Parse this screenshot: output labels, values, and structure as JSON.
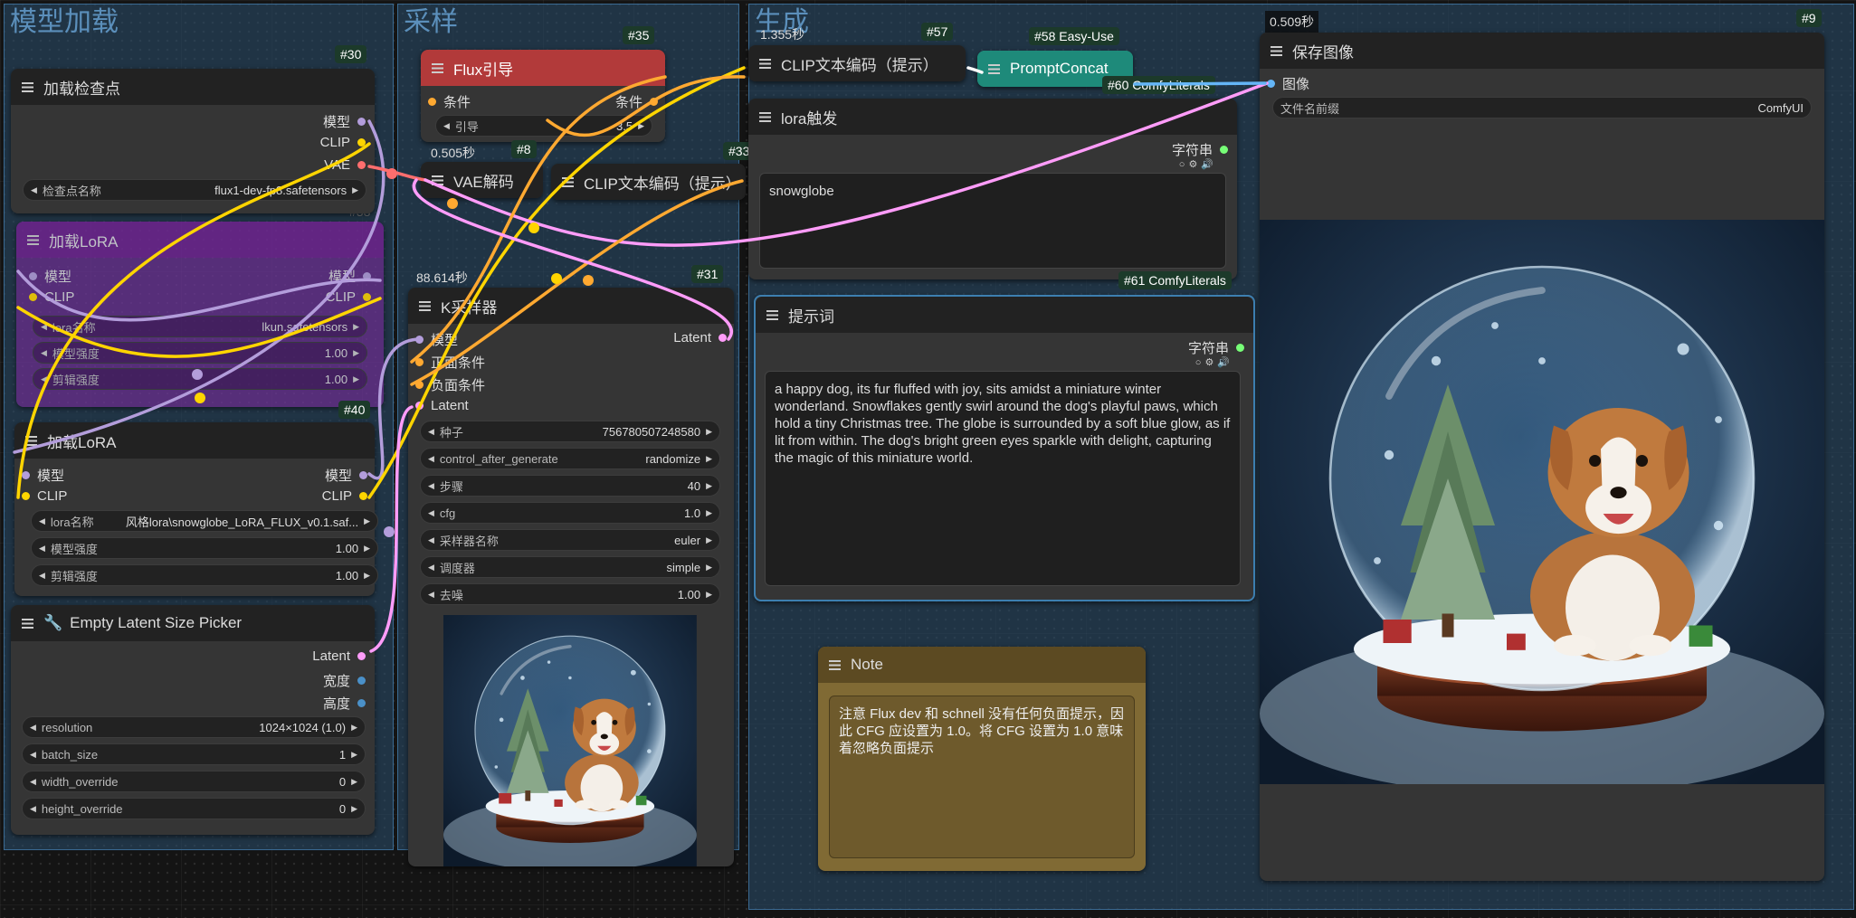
{
  "groups": {
    "load": "模型加载",
    "sample": "采样",
    "gen": "生成"
  },
  "colors": {
    "model": "#b39ddb",
    "clip": "#ffd500",
    "vae": "#ff6e6e",
    "cond": "#ffa931",
    "latent": "#ff9cf9",
    "string": "#77ff77",
    "image": "#64b5f6",
    "int": "#4a90c8"
  },
  "nodes": {
    "checkpoint": {
      "id": "#30",
      "title": "加载检查点",
      "out_model": "模型",
      "out_clip": "CLIP",
      "out_vae": "VAE",
      "w_name": "检查点名称",
      "w_value": "flux1-dev-fp8.safetensors"
    },
    "lora_bypass": {
      "id": "#38",
      "title": "加载LoRA",
      "in_model": "模型",
      "in_clip": "CLIP",
      "out_model": "模型",
      "out_clip": "CLIP",
      "w1": "lora名称",
      "w1v": "lkun.safetensors",
      "w2": "模型强度",
      "w2v": "1.00",
      "w3": "剪辑强度",
      "w3v": "1.00"
    },
    "lora": {
      "id": "#40",
      "title": "加载LoRA",
      "in_model": "模型",
      "in_clip": "CLIP",
      "out_model": "模型",
      "out_clip": "CLIP",
      "w1": "lora名称",
      "w1v": "风格lora\\snowglobe_LoRA_FLUX_v0.1.saf...",
      "w2": "模型强度",
      "w2v": "1.00",
      "w3": "剪辑强度",
      "w3v": "1.00"
    },
    "latent": {
      "title": "Empty Latent Size Picker",
      "out1": "Latent",
      "out2": "宽度",
      "out3": "高度",
      "w": [
        {
          "n": "resolution",
          "v": "1024×1024 (1.0)"
        },
        {
          "n": "batch_size",
          "v": "1"
        },
        {
          "n": "width_override",
          "v": "0"
        },
        {
          "n": "height_override",
          "v": "0"
        }
      ]
    },
    "flux": {
      "id": "#35",
      "title": "Flux引导",
      "in": "条件",
      "out": "条件",
      "w_name": "引导",
      "w_value": "3.5"
    },
    "vae": {
      "id": "#8",
      "timer": "0.505秒",
      "title": "VAE解码"
    },
    "clip_neg": {
      "id": "#33",
      "title": "CLIP文本编码（提示）"
    },
    "ksampler": {
      "id": "#31",
      "timer": "88.614秒",
      "title": "K采样器",
      "in1": "模型",
      "in2": "正面条件",
      "in3": "负面条件",
      "in4": "Latent",
      "out": "Latent",
      "w": [
        {
          "n": "种子",
          "v": "756780507248580"
        },
        {
          "n": "control_after_generate",
          "v": "randomize"
        },
        {
          "n": "步骤",
          "v": "40"
        },
        {
          "n": "cfg",
          "v": "1.0"
        },
        {
          "n": "采样器名称",
          "v": "euler"
        },
        {
          "n": "调度器",
          "v": "simple"
        },
        {
          "n": "去噪",
          "v": "1.00"
        }
      ]
    },
    "clip_pos": {
      "id": "#57",
      "timer": "1.355秒",
      "title": "CLIP文本编码（提示）"
    },
    "concat": {
      "id": "#58 Easy-Use",
      "title": "PromptConcat"
    },
    "lit60": {
      "id": "#60 ComfyLiterals"
    },
    "lora_trigger": {
      "title": "lora触发",
      "out": "字符串",
      "text": "snowglobe"
    },
    "lit61": {
      "id": "#61 ComfyLiterals"
    },
    "prompt": {
      "title": "提示词",
      "out": "字符串",
      "text": "a happy dog, its fur fluffed with joy, sits amidst a miniature winter wonderland. Snowflakes gently swirl around the dog's playful paws, which hold a tiny Christmas tree. The globe is surrounded by a soft blue glow, as if lit from within. The dog's bright green eyes sparkle with delight, capturing the magic of this miniature world."
    },
    "note": {
      "title": "Note",
      "text": "注意 Flux dev 和 schnell 没有任何负面提示，因此 CFG 应设置为 1.0。将 CFG 设置为 1.0 意味着忽略负面提示"
    },
    "save": {
      "id": "#9",
      "timer": "0.509秒",
      "title": "保存图像",
      "in": "图像",
      "w_name": "文件名前缀",
      "w_value": "ComfyUI"
    }
  },
  "image_alt": "snowglobe dog preview"
}
